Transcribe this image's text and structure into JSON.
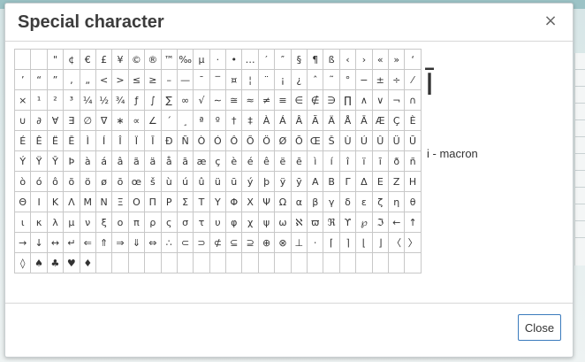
{
  "dialog": {
    "title": "Special character",
    "close_icon": "×",
    "close_button_label": "Close"
  },
  "preview": {
    "char": "Ī",
    "name": "i - macron"
  },
  "colors": {
    "button_border": "#3b7bbd",
    "title_text": "#3c3c3c"
  },
  "rows": [
    [
      "",
      "",
      "\"",
      "¢",
      "€",
      "£",
      "¥",
      "©",
      "®",
      "™",
      "‰",
      "µ",
      "·",
      "•",
      "…",
      "′",
      "″",
      "§",
      "¶",
      "ß",
      "‹",
      "›",
      "«",
      "»",
      "‘"
    ],
    [
      "’",
      "“",
      "”",
      "‚",
      "„",
      "<",
      ">",
      "≤",
      "≥",
      "–",
      "—",
      "¯",
      "‾",
      "¤",
      "¦",
      "¨",
      "¡",
      "¿",
      "ˆ",
      "˜",
      "°",
      "−",
      "±",
      "÷",
      "⁄"
    ],
    [
      "×",
      "¹",
      "²",
      "³",
      "¼",
      "½",
      "¾",
      "ƒ",
      "∫",
      "∑",
      "∞",
      "√",
      "∼",
      "≅",
      "≈",
      "≠",
      "≡",
      "∈",
      "∉",
      "∋",
      "∏",
      "∧",
      "∨",
      "¬",
      "∩"
    ],
    [
      "∪",
      "∂",
      "∀",
      "∃",
      "∅",
      "∇",
      "∗",
      "∝",
      "∠",
      "´",
      "¸",
      "ª",
      "º",
      "†",
      "‡",
      "À",
      "Á",
      "Â",
      "Ã",
      "Ä",
      "Å",
      "Ā",
      "Æ",
      "Ç",
      "È"
    ],
    [
      "É",
      "Ê",
      "Ë",
      "Ē",
      "Ì",
      "Í",
      "Î",
      "Ï",
      "Ī",
      "Ð",
      "Ñ",
      "Ò",
      "Ó",
      "Ô",
      "Õ",
      "Ö",
      "Ø",
      "Ō",
      "Œ",
      "Š",
      "Ù",
      "Ú",
      "Û",
      "Ü",
      "Ū"
    ],
    [
      "Ý",
      "Ÿ",
      "Ȳ",
      "Þ",
      "à",
      "á",
      "â",
      "ã",
      "ä",
      "å",
      "ā",
      "æ",
      "ç",
      "è",
      "é",
      "ê",
      "ë",
      "ē",
      "ì",
      "í",
      "î",
      "ï",
      "ī",
      "ð",
      "ñ"
    ],
    [
      "ò",
      "ó",
      "ô",
      "õ",
      "ö",
      "ø",
      "ō",
      "œ",
      "š",
      "ù",
      "ú",
      "û",
      "ü",
      "ū",
      "ý",
      "þ",
      "ÿ",
      "ȳ",
      "Α",
      "Β",
      "Γ",
      "Δ",
      "Ε",
      "Ζ",
      "Η"
    ],
    [
      "Θ",
      "Ι",
      "Κ",
      "Λ",
      "Μ",
      "Ν",
      "Ξ",
      "Ο",
      "Π",
      "Ρ",
      "Σ",
      "Τ",
      "Υ",
      "Φ",
      "Χ",
      "Ψ",
      "Ω",
      "α",
      "β",
      "γ",
      "δ",
      "ε",
      "ζ",
      "η",
      "θ"
    ],
    [
      "ι",
      "κ",
      "λ",
      "μ",
      "ν",
      "ξ",
      "ο",
      "π",
      "ρ",
      "ς",
      "σ",
      "τ",
      "υ",
      "φ",
      "χ",
      "ψ",
      "ω",
      "ℵ",
      "ϖ",
      "ℜ",
      "ϒ",
      "℘",
      "ℑ",
      "←",
      "↑"
    ],
    [
      "→",
      "↓",
      "↔",
      "↵",
      "⇐",
      "⇑",
      "⇒",
      "⇓",
      "⇔",
      "∴",
      "⊂",
      "⊃",
      "⊄",
      "⊆",
      "⊇",
      "⊕",
      "⊗",
      "⊥",
      "⋅",
      "⌈",
      "⌉",
      "⌊",
      "⌋",
      "〈",
      "〉"
    ],
    [
      "◊",
      "♠",
      "♣",
      "♥",
      "♦",
      "",
      "",
      "",
      "",
      "",
      "",
      "",
      "",
      "",
      "",
      "",
      "",
      "",
      "",
      "",
      "",
      "",
      "",
      "",
      ""
    ]
  ]
}
